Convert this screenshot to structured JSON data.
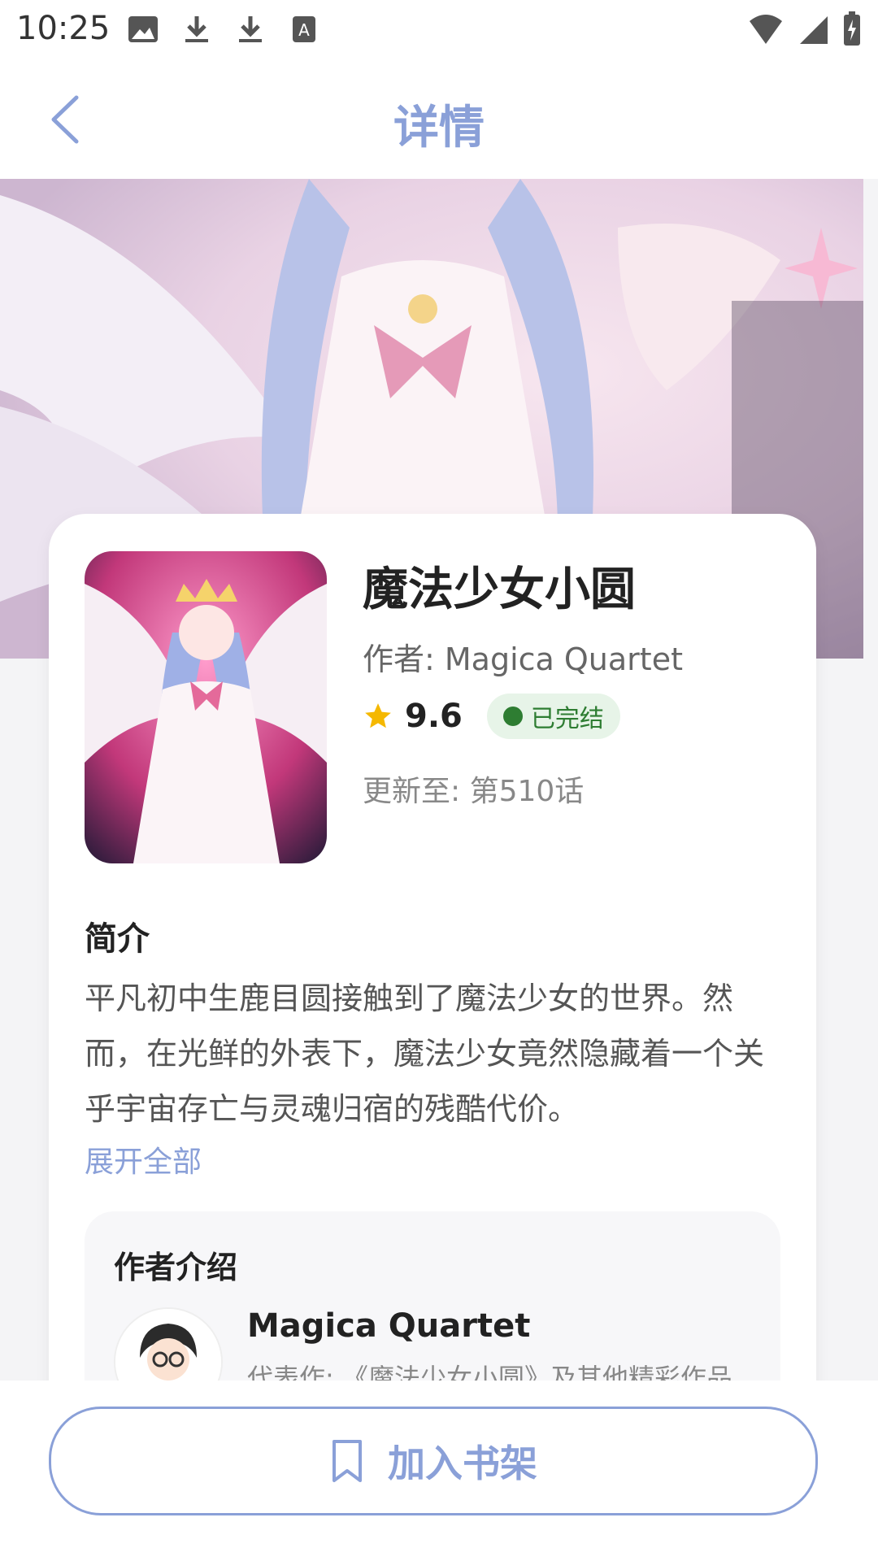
{
  "status_bar": {
    "time": "10:25"
  },
  "header": {
    "title": "详情",
    "back_icon": "chevron-left-icon"
  },
  "book": {
    "title": "魔法少女小圆",
    "author": "作者: Magica Quartet",
    "rating": "9.6",
    "status": "已完结",
    "update": "更新至: 第510话"
  },
  "intro": {
    "title": "简介",
    "text": "平凡初中生鹿目圆接触到了魔法少女的世界。然而，在光鲜的外表下，魔法少女竟然隐藏着一个关乎宇宙存亡与灵魂归宿的残酷代价。",
    "expand_label": "展开全部"
  },
  "author_section": {
    "title": "作者介绍",
    "name": "Magica Quartet",
    "works": "代表作: 《魔法少女小圆》及其他精彩作品"
  },
  "bottom": {
    "add_shelf_label": "加入书架",
    "icon": "bookmark-icon"
  },
  "colors": {
    "accent": "#8aa0d8",
    "status_green": "#2e7d32",
    "status_bg": "#e7f4e8"
  }
}
